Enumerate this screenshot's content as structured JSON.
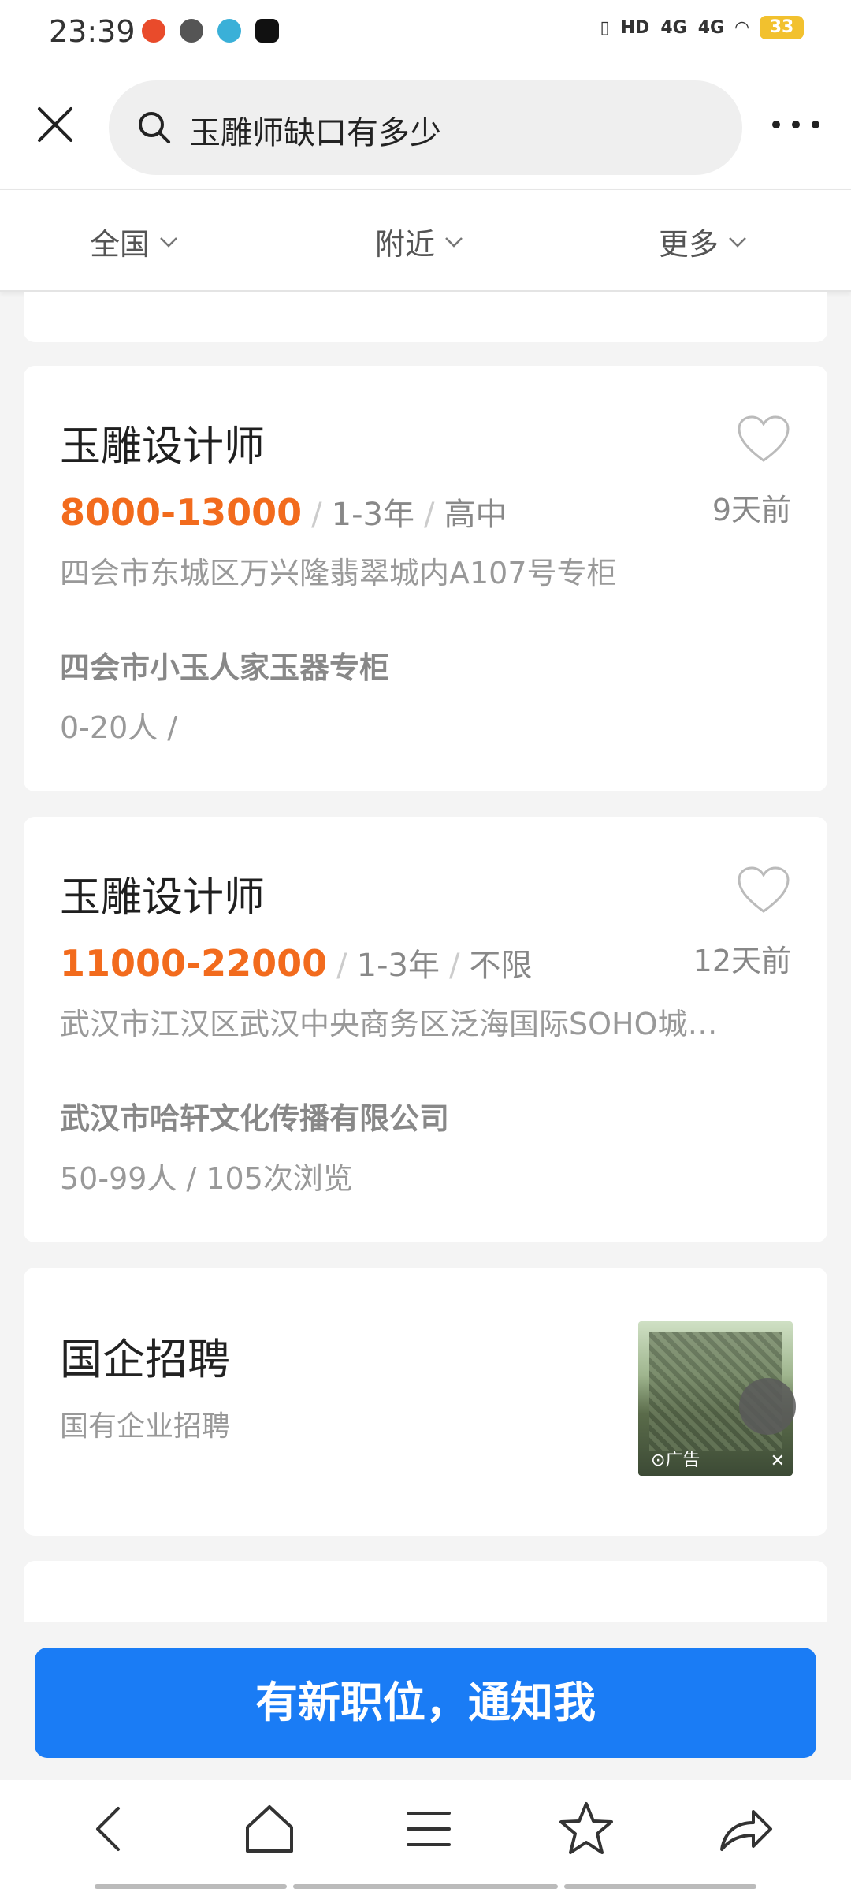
{
  "status_bar": {
    "time": "23:39",
    "signal_1": "4G",
    "signal_2": "4G",
    "hd": "HD",
    "battery": "33"
  },
  "search": {
    "query": "玉雕师缺口有多少"
  },
  "filters": [
    {
      "label": "全国"
    },
    {
      "label": "附近"
    },
    {
      "label": "更多"
    }
  ],
  "jobs": [
    {
      "title": "玉雕设计师",
      "salary": "8000-13000",
      "experience": "1-3年",
      "education": "高中",
      "posted": "9天前",
      "address": "四会市东城区万兴隆翡翠城内A107号专柜",
      "company": "四会市小玉人家玉器专柜",
      "meta": "0-20人 /"
    },
    {
      "title": "玉雕设计师",
      "salary": "11000-22000",
      "experience": "1-3年",
      "education": "不限",
      "posted": "12天前",
      "address": "武汉市江汉区武汉中央商务区泛海国际SOHO城…",
      "company": "武汉市哈轩文化传播有限公司",
      "meta": "50-99人 / 105次浏览"
    }
  ],
  "ad": {
    "title": "国企招聘",
    "subtitle": "国有企业招聘",
    "label": "⊙广告",
    "close": "✕"
  },
  "cta": {
    "label": "有新职位，通知我"
  },
  "colors": {
    "salary": "#f26b1d",
    "cta": "#1a7cf5"
  }
}
